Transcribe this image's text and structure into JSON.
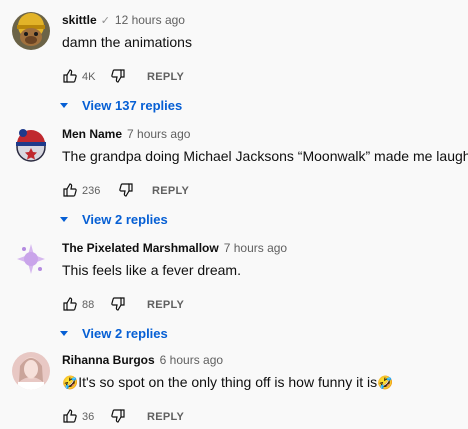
{
  "comments": [
    {
      "author": "skittle",
      "verified": "✓",
      "time": "12 hours ago",
      "text": "damn the animations",
      "likes": "4K",
      "reply_label": "REPLY",
      "replies_label": "View 137 replies",
      "avatar": "dog-in-helmet-avatar"
    },
    {
      "author": "Men Name",
      "time": "7 hours ago",
      "text": "The grandpa doing Michael Jacksons “Moonwalk” made me laugh af",
      "likes": "236",
      "reply_label": "REPLY",
      "replies_label": "View 2 replies",
      "avatar": "ball-character-avatar"
    },
    {
      "author": "The Pixelated Marshmallow",
      "time": "7 hours ago",
      "text": "This feels like a fever dream.",
      "likes": "88",
      "reply_label": "REPLY",
      "replies_label": "View 2 replies",
      "avatar": "purple-sparkle-avatar"
    },
    {
      "author": "Rihanna Burgos",
      "time": "6 hours ago",
      "text_emoji_start": "🤣",
      "text": "It's so spot on the only thing off is how funny it is",
      "text_emoji_end": "🤣",
      "likes": "36",
      "reply_label": "REPLY",
      "avatar": "girl-portrait-avatar"
    }
  ],
  "colors": {
    "link_blue": "#065fd4",
    "meta_gray": "#606060",
    "background": "#f9f9f9"
  }
}
